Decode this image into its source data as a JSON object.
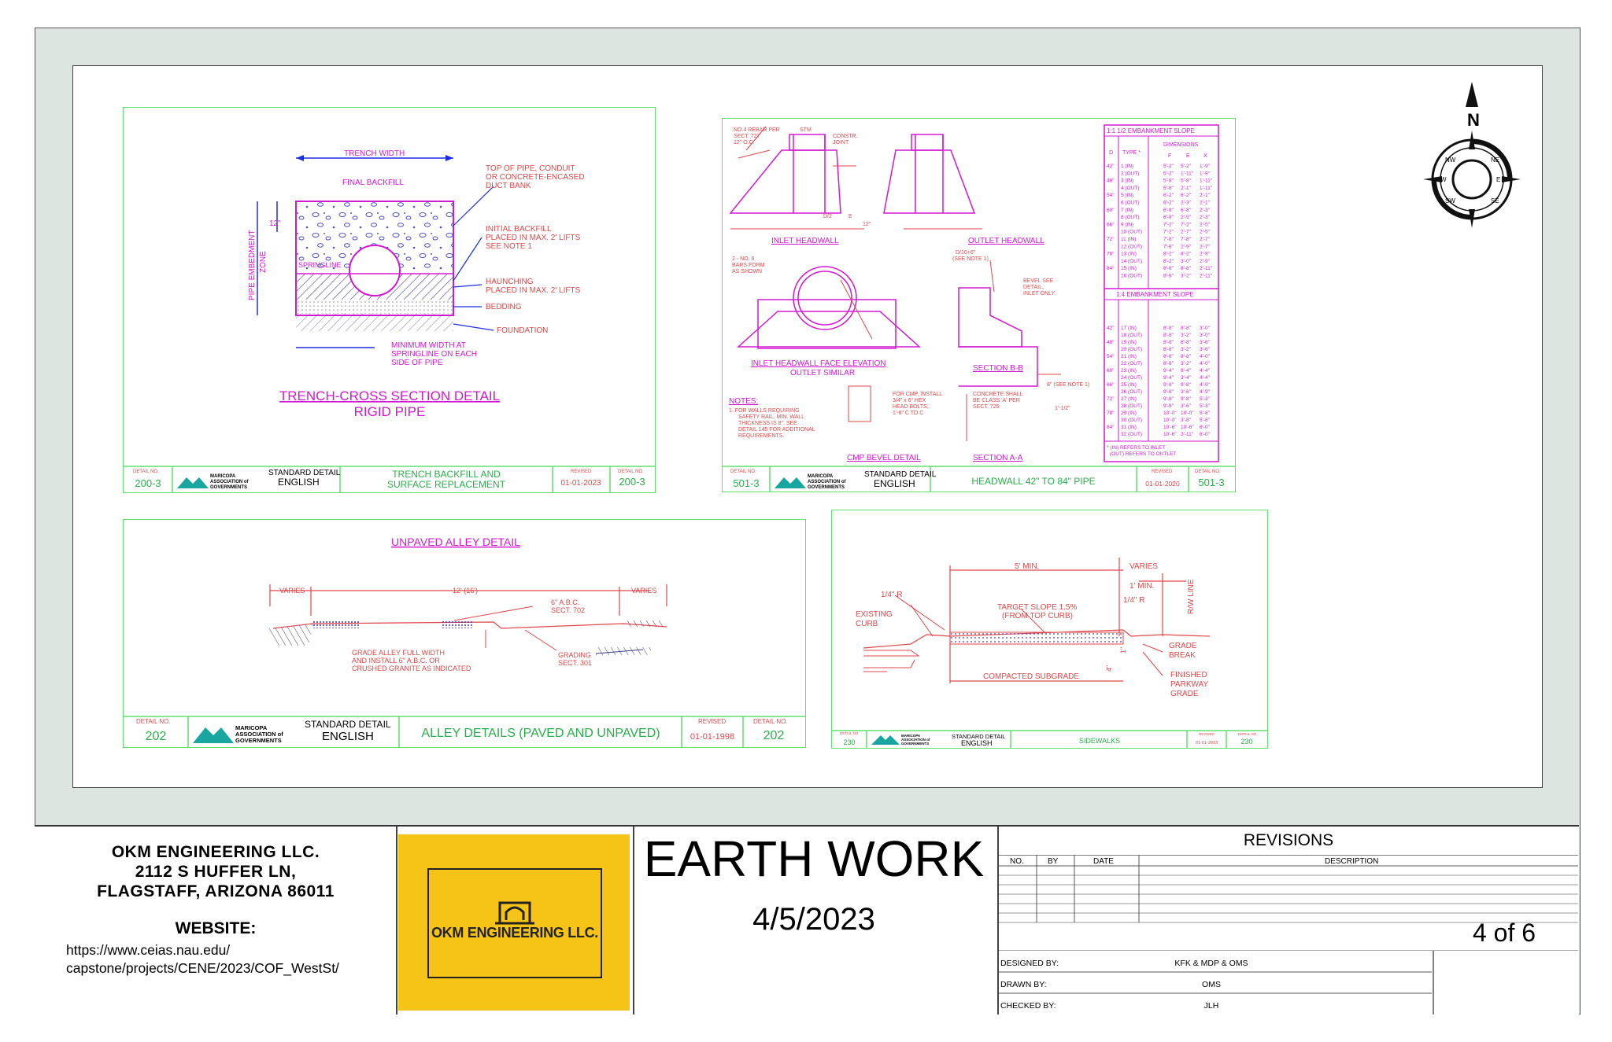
{
  "panels": {
    "trench": {
      "labels": [
        "TRENCH WIDTH",
        "FINAL BACKFILL",
        "TOP OF PIPE, CONDUIT",
        "OR CONCRETE-ENCASED",
        "DUCT BANK",
        "INITIAL BACKFILL",
        "PLACED IN MAX. 2' LIFTS",
        "SEE NOTE 1",
        "HAUNCHING",
        "PLACED IN MAX. 2' LIFTS",
        "BEDDING",
        "FOUNDATION",
        "MINIMUM WIDTH AT",
        "SPRINGLINE ON EACH",
        "SIDE OF PIPE",
        "SPRINGLINE",
        "12\"",
        "PIPE EMBEDMENT",
        "ZONE"
      ],
      "title": "TRENCH-CROSS SECTION DETAIL",
      "subtitle": "RIGID PIPE",
      "detail_no_label": "DETAIL NO.",
      "detail_no": "200-3",
      "org": [
        "MARICOPA",
        "ASSOCIATION of",
        "GOVERNMENTS"
      ],
      "std": "STANDARD DETAIL",
      "english": "ENGLISH",
      "name": [
        "TRENCH BACKFILL AND",
        "SURFACE REPLACEMENT"
      ],
      "revised_label": "REVISED",
      "revised": "01-01-2023"
    },
    "headwall": {
      "labels": [
        "NO.4 REBAR PER",
        "SECT. 727",
        "12\" O.C.",
        "STM",
        "CONSTR.",
        "JOINT",
        "D/2",
        "12\"",
        "E",
        "INLET HEADWALL",
        "OUTLET HEADWALL",
        "2 - NO. 6",
        "BARS FORM",
        "AS SHOWN",
        "INLET HEADWALL FACE ELEVATION",
        "OUTLET SIMILAR",
        "SECTION B-B",
        "SECTION A-A",
        "CMP BEVEL DETAIL",
        "BEVEL SEE",
        "DETAIL,",
        "INLET ONLY",
        "D/16+6\"",
        "(SEE NOTE 1)",
        "FOR CMP, INSTALL",
        "3/4\" x 6\" HEX",
        "HEAD BOLTS,",
        "1'-6\" C TO C",
        "CONCRETE SHALL",
        "BE CLASS 'A' PER",
        "SECT. 725",
        "8\" (SEE NOTE 1)",
        "1'-1/2\""
      ],
      "notes_title": "NOTES:",
      "notes": [
        "1.  FOR WALLS REQUIRING",
        "SAFETY RAIL, MIN. WALL",
        "THICKNESS IS 8\". SEE",
        "DETAIL 145 FOR ADDITIONAL",
        "REQUIREMENTS."
      ],
      "table1_title": "1:1 1/2 EMBANKMENT SLOPE",
      "table2_title": "1:4 EMBANKMENT SLOPE",
      "table_headers": [
        "D",
        "TYPE *",
        "DIMENSIONS",
        "F",
        "E",
        "X"
      ],
      "table1_rows": [
        [
          "42\"",
          "1 (IN)",
          "5'-2\"",
          "5'-2\"",
          "1'-9\""
        ],
        [
          "",
          "2 (OUT)",
          "5'-2\"",
          "1'-11\"",
          "1'-9\""
        ],
        [
          "48\"",
          "3 (IN)",
          "5'-8\"",
          "5'-8\"",
          "1'-11\""
        ],
        [
          "",
          "4 (OUT)",
          "5'-8\"",
          "2'-1\"",
          "1'-11\""
        ],
        [
          "54\"",
          "5 (IN)",
          "6'-2\"",
          "6'-2\"",
          "2'-1\""
        ],
        [
          "",
          "6 (OUT)",
          "6'-2\"",
          "2'-3\"",
          "2'-1\""
        ],
        [
          "60\"",
          "7 (IN)",
          "6'-8\"",
          "6'-8\"",
          "2'-3\""
        ],
        [
          "",
          "8 (OUT)",
          "6'-8\"",
          "2'-5\"",
          "2'-3\""
        ],
        [
          "66\"",
          "9 (IN)",
          "7'-2\"",
          "7'-2\"",
          "2'-5\""
        ],
        [
          "",
          "10 (OUT)",
          "7'-2\"",
          "2'-7\"",
          "2'-5\""
        ],
        [
          "72\"",
          "11 (IN)",
          "7'-8\"",
          "7'-8\"",
          "2'-7\""
        ],
        [
          "",
          "12 (OUT)",
          "7'-8\"",
          "2'-9\"",
          "2'-7\""
        ],
        [
          "78\"",
          "13 (IN)",
          "8'-2\"",
          "8'-2\"",
          "2'-9\""
        ],
        [
          "",
          "14 (OUT)",
          "8'-2\"",
          "3'-0\"",
          "2'-9\""
        ],
        [
          "84\"",
          "15 (IN)",
          "8'-8\"",
          "8'-8\"",
          "2'-11\""
        ],
        [
          "",
          "16 (OUT)",
          "8'-8\"",
          "3'-2\"",
          "2'-11\""
        ]
      ],
      "table2_rows": [
        [
          "42\"",
          "17 (IN)",
          "8'-8\"",
          "8'-8\"",
          "3'-0\""
        ],
        [
          "",
          "18 (OUT)",
          "8'-8\"",
          "3'-2\"",
          "3'-0\""
        ],
        [
          "48\"",
          "19 (IN)",
          "8'-8\"",
          "8'-8\"",
          "3'-6\""
        ],
        [
          "",
          "20 (OUT)",
          "8'-8\"",
          "3'-2\"",
          "3'-6\""
        ],
        [
          "54\"",
          "21 (IN)",
          "8'-8\"",
          "8'-8\"",
          "4'-0\""
        ],
        [
          "",
          "22 (OUT)",
          "8'-8\"",
          "3'-2\"",
          "4'-0\""
        ],
        [
          "60\"",
          "23 (IN)",
          "9'-4\"",
          "9'-4\"",
          "4'-4\""
        ],
        [
          "",
          "24 (OUT)",
          "9'-4\"",
          "3'-4\"",
          "4'-4\""
        ],
        [
          "66\"",
          "25 (IN)",
          "9'-8\"",
          "9'-8\"",
          "4'-9\""
        ],
        [
          "",
          "26 (OUT)",
          "9'-8\"",
          "3'-6\"",
          "4'-9\""
        ],
        [
          "72\"",
          "27 (IN)",
          "9'-8\"",
          "9'-8\"",
          "5'-3\""
        ],
        [
          "",
          "28 (OUT)",
          "9'-8\"",
          "3'-6\"",
          "5'-3\""
        ],
        [
          "78\"",
          "29 (IN)",
          "10'-0\"",
          "10'-0\"",
          "5'-8\""
        ],
        [
          "",
          "30 (OUT)",
          "10'-0\"",
          "3'-8\"",
          "5'-8\""
        ],
        [
          "84\"",
          "31 (IN)",
          "10'-6\"",
          "10'-6\"",
          "6'-0\""
        ],
        [
          "",
          "32 (OUT)",
          "10'-6\"",
          "3'-11\"",
          "6'-0\""
        ]
      ],
      "footnote": [
        "* (IN) REFERS TO INLET",
        "(OUT) REFERS TO OUTLET"
      ],
      "detail_no_label": "DETAIL NO.",
      "detail_no": "501-3",
      "org": [
        "MARICOPA",
        "ASSOCIATION of",
        "GOVERNMENTS"
      ],
      "std": "STANDARD DETAIL",
      "english": "ENGLISH",
      "name": "HEADWALL 42\" TO 84\" PIPE",
      "revised_label": "REVISED",
      "revised": "01-01-2020"
    },
    "alley": {
      "title": "UNPAVED ALLEY DETAIL",
      "labels": [
        "VARIES",
        "12' (16')",
        "VARIES",
        "6\" A.B.C.",
        "SECT. 702",
        "GRADE ALLEY FULL WIDTH",
        "AND INSTALL 6\" A.B.C. OR",
        "CRUSHED GRANITE AS INDICATED",
        "GRADING",
        "SECT. 301"
      ],
      "detail_no_label": "DETAIL NO.",
      "detail_no": "202",
      "org": [
        "MARICOPA",
        "ASSOCIATION of",
        "GOVERNMENTS"
      ],
      "std": "STANDARD DETAIL",
      "english": "ENGLISH",
      "name": "ALLEY DETAILS (PAVED AND UNPAVED)",
      "revised_label": "REVISED",
      "revised": "01-01-1998"
    },
    "sidewalk": {
      "labels": [
        "5' MIN.",
        "VARIES",
        "1' MIN.",
        "1/4\" R",
        "1/4\" R",
        "R/W LINE",
        "EXISTING",
        "CURB",
        "TARGET SLOPE 1.5%",
        "(FROM TOP CURB)",
        "GRADE",
        "BREAK",
        "COMPACTED SUBGRADE",
        "FINISHED",
        "PARKWAY",
        "GRADE",
        "4\"",
        "1\""
      ],
      "detail_no_label": "DETAIL NO.",
      "detail_no": "230",
      "org": [
        "MARICOPA",
        "ASSOCIATION of",
        "GOVERNMENTS"
      ],
      "std": "STANDARD DETAIL",
      "english": "ENGLISH",
      "name": "SIDEWALKS",
      "revised_label": "REVISED",
      "revised": "01-01-2023"
    }
  },
  "north_arrow": {
    "label": "N",
    "dirs": [
      "SW",
      "NW",
      "NE",
      "SE",
      "E",
      "W"
    ]
  },
  "titleblock": {
    "firm_name": "OKM ENGINEERING LLC.",
    "address1": "2112 S HUFFER LN,",
    "address2": "FLAGSTAFF, ARIZONA 86011",
    "website_label": "WEBSITE:",
    "website_line1": "https://www.ceias.nau.edu/",
    "website_line2": "capstone/projects/CENE/2023/COF_WestSt/",
    "logo_text": "OKM ENGINEERING LLC.",
    "sheet_title": "EARTH WORK",
    "date": "4/5/2023",
    "revisions_title": "REVISIONS",
    "rev_headers": {
      "no": "NO.",
      "by": "BY",
      "date": "DATE",
      "description": "DESCRIPTION"
    },
    "designed_label": "DESIGNED BY:",
    "designed_value": "KFK & MDP & OMS",
    "drawn_label": "DRAWN BY:",
    "drawn_value": "OMS",
    "checked_label": "CHECKED BY:",
    "checked_value": "JLH",
    "sheet_number": "4 of 6"
  },
  "colors": {
    "line": "#e0474a",
    "dim": "#d318d3",
    "frame": "#5fe06a",
    "fill": "#d8d8f2",
    "dots": "#5050c8",
    "logo": "#f6c417",
    "sheet_bg": "#dde5e1"
  }
}
